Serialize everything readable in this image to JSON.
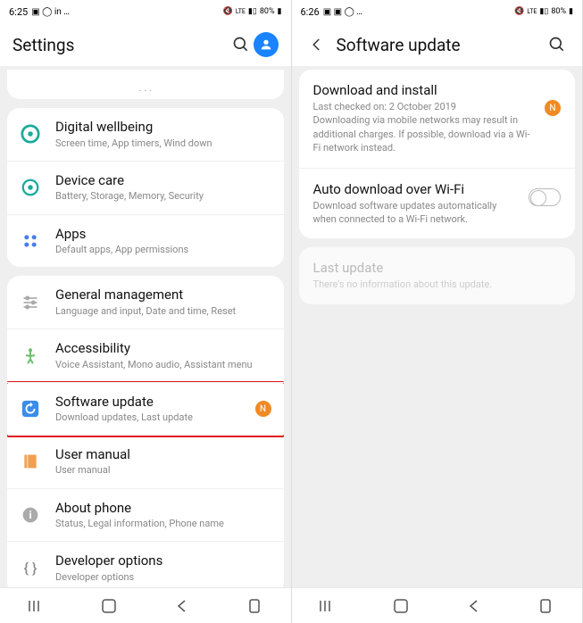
{
  "left": {
    "status": {
      "time": "6:25",
      "battery": "80%",
      "net": "LTE"
    },
    "header": {
      "title": "Settings"
    },
    "truncated_hint": ". . .",
    "groups": [
      {
        "items": [
          {
            "icon": "wellbeing",
            "title": "Digital wellbeing",
            "sub": "Screen time, App timers, Wind down"
          },
          {
            "icon": "care",
            "title": "Device care",
            "sub": "Battery, Storage, Memory, Security"
          },
          {
            "icon": "apps",
            "title": "Apps",
            "sub": "Default apps, App permissions"
          }
        ]
      },
      {
        "items": [
          {
            "icon": "general",
            "title": "General management",
            "sub": "Language and input, Date and time, Reset"
          },
          {
            "icon": "accessibility",
            "title": "Accessibility",
            "sub": "Voice Assistant, Mono audio, Assistant menu"
          },
          {
            "icon": "update",
            "title": "Software update",
            "sub": "Download updates, Last update",
            "badge": "N",
            "highlighted": true
          },
          {
            "icon": "manual",
            "title": "User manual",
            "sub": "User manual"
          },
          {
            "icon": "about",
            "title": "About phone",
            "sub": "Status, Legal information, Phone name"
          },
          {
            "icon": "dev",
            "title": "Developer options",
            "sub": "Developer options"
          }
        ]
      }
    ]
  },
  "right": {
    "status": {
      "time": "6:26",
      "battery": "80%",
      "net": "LTE"
    },
    "header": {
      "title": "Software update"
    },
    "items": [
      {
        "title": "Download and install",
        "sub": "Last checked on: 2 October 2019\nDownloading via mobile networks may result in additional charges. If possible, download via a Wi-Fi network instead.",
        "badge": "N"
      },
      {
        "title": "Auto download over Wi-Fi",
        "sub": "Download software updates automatically when connected to a Wi-Fi network.",
        "toggle": true
      }
    ],
    "last_update": {
      "title": "Last update",
      "sub": "There's no information about this update."
    }
  }
}
